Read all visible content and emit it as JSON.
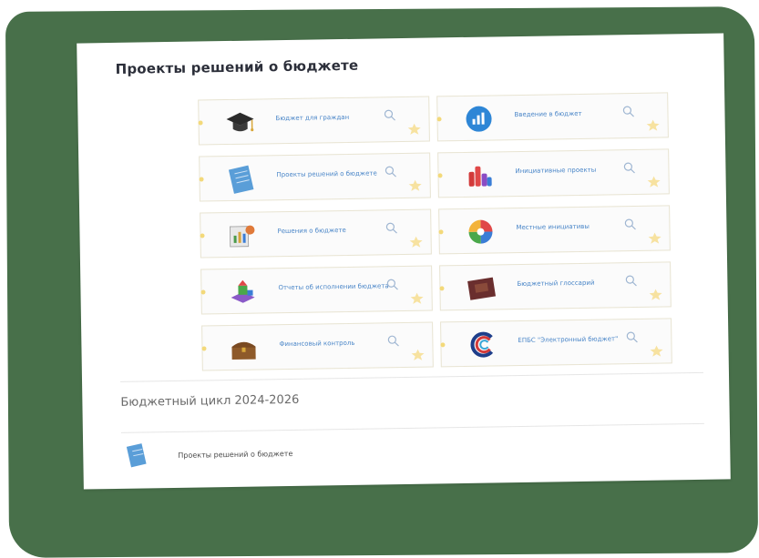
{
  "page": {
    "title": "Проекты решений о бюджете"
  },
  "cards": [
    {
      "label": "Бюджет для граждан",
      "icon": "graduation-cap-icon"
    },
    {
      "label": "Введение в бюджет",
      "icon": "bar-chart-circle-icon"
    },
    {
      "label": "Проекты решений о бюджете",
      "icon": "document-icon"
    },
    {
      "label": "Инициативные проекты",
      "icon": "raised-hands-icon"
    },
    {
      "label": "Решения о бюджете",
      "icon": "charts-folder-icon"
    },
    {
      "label": "Местные инициативы",
      "icon": "colorful-globe-icon"
    },
    {
      "label": "Отчеты об исполнении бюджета",
      "icon": "stacked-blocks-icon"
    },
    {
      "label": "Бюджетный глоссарий",
      "icon": "book-icon"
    },
    {
      "label": "Финансовый контроль",
      "icon": "treasure-chest-icon"
    },
    {
      "label": "ЕПБС \"Электронный бюджет\"",
      "icon": "e-budget-logo-icon"
    }
  ],
  "budget_cycle": {
    "title": "Бюджетный цикл 2024-2026",
    "items": [
      {
        "label": "Проекты решений о бюджете",
        "icon": "document-icon"
      }
    ]
  },
  "colors": {
    "frame": "#48704a",
    "link": "#4a86c8",
    "accent_star": "#f3c64a"
  }
}
